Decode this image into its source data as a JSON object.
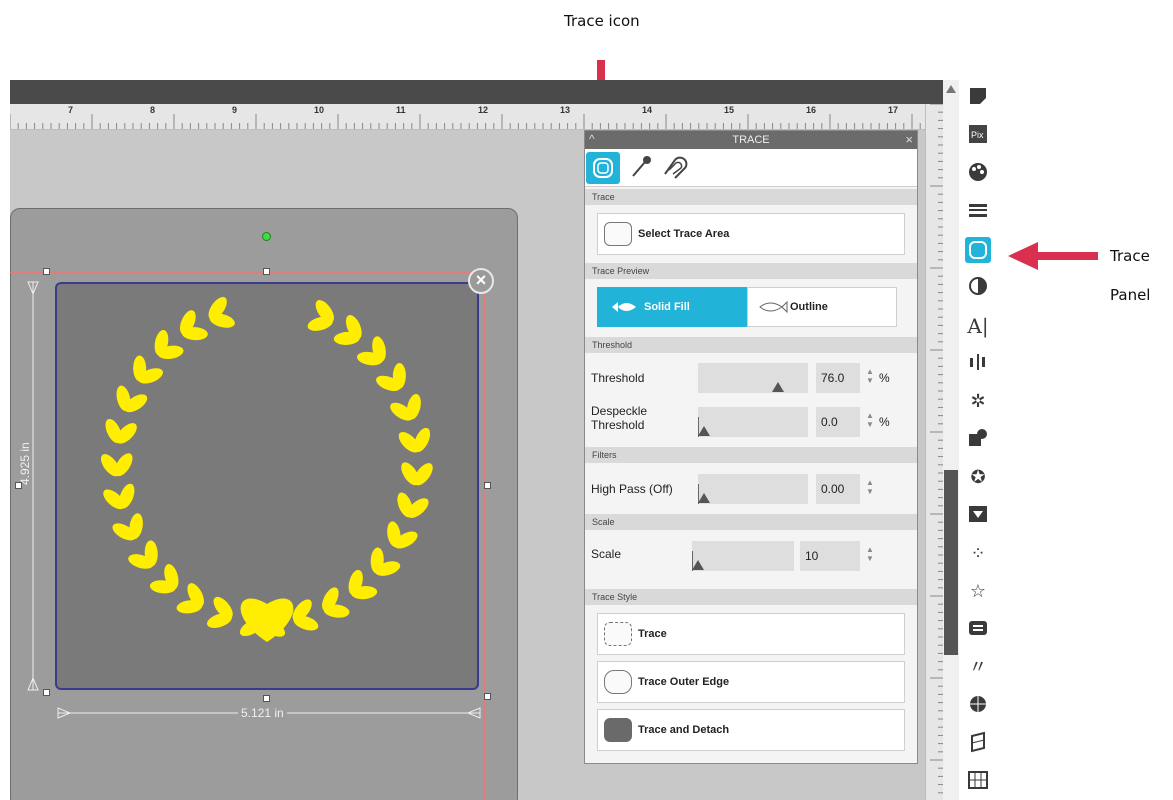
{
  "annotations": {
    "trace_icon_label": "Trace icon",
    "trace_panel_label_1": "Trace",
    "trace_panel_label_2": "Panel",
    "arrow_color": "#d9304f"
  },
  "ruler": {
    "numbers": [
      "7",
      "8",
      "9",
      "10",
      "11",
      "12",
      "13",
      "14",
      "15",
      "16",
      "17"
    ]
  },
  "selection": {
    "height_label": "4.925 in",
    "width_label": "5.121 in"
  },
  "panel": {
    "title": "TRACE",
    "collapse": "^",
    "close": "×",
    "tabs": [
      "trace-tab",
      "eyedropper-tab",
      "magnet-tab"
    ],
    "sections": {
      "trace": "Trace",
      "trace_preview": "Trace Preview",
      "threshold": "Threshold",
      "filters": "Filters",
      "scale": "Scale",
      "trace_style": "Trace Style"
    },
    "select_trace_area": "Select Trace Area",
    "preview": {
      "solid_fill": "Solid Fill",
      "outline": "Outline"
    },
    "threshold": {
      "label": "Threshold",
      "value": "76.0",
      "unit": "%",
      "level": 0.76
    },
    "despeckle": {
      "label_1": "Despeckle",
      "label_2": "Threshold",
      "value": "0.0",
      "unit": "%",
      "level": 0.0
    },
    "high_pass": {
      "label": "High Pass (Off)",
      "value": "0.00",
      "level": 0.0
    },
    "scale": {
      "label": "Scale",
      "value": "10",
      "level": 0.0
    },
    "styles": {
      "trace": "Trace",
      "trace_outer_edge": "Trace Outer Edge",
      "trace_and_detach": "Trace and Detach"
    }
  },
  "toolbar": {
    "icons": [
      "page-setup-icon",
      "pixscan-icon",
      "fill-palette-icon",
      "line-style-icon",
      "trace-panel-icon",
      "transparency-icon",
      "text-icon",
      "align-icon",
      "replicate-icon",
      "modify-icon",
      "design-star-icon",
      "offset-icon",
      "rhinestone-icon",
      "star-outline-icon",
      "layers-icon",
      "sketch-icon",
      "library-icon",
      "3d-icon",
      "map-icon"
    ]
  },
  "colors": {
    "accent": "#22b3d9",
    "artwork": "#ffee00"
  }
}
